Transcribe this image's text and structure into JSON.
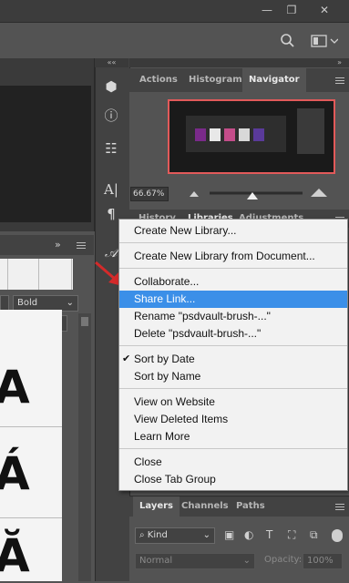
{
  "window": {
    "minimize_icon": "minimize-icon",
    "restore_icon": "restore-icon",
    "close_icon": "close-icon"
  },
  "options_bar": {
    "search_icon": "search-icon",
    "workspace_icon": "workspace-icon"
  },
  "dock": {
    "collapse_label": "««",
    "icons": [
      "3d-icon",
      "info-icon",
      "properties-icon",
      "character-icon",
      "paragraph-icon",
      "glyphs-icon"
    ]
  },
  "panel_strip": {
    "expand_label": "»"
  },
  "navigator_panel": {
    "tabs": [
      {
        "label": "Actions",
        "active": false
      },
      {
        "label": "Histogram",
        "active": false
      },
      {
        "label": "Navigator",
        "active": true
      }
    ],
    "zoom": "66.67%"
  },
  "libraries_tabs": {
    "tabs": [
      "History",
      "Libraries",
      "Adjustments"
    ]
  },
  "glyph_panel": {
    "expand_label": "»",
    "font_style": "Bold",
    "glyphs": [
      "A",
      "Á",
      "Ă"
    ]
  },
  "context_menu": {
    "items": [
      {
        "label": "Create New Library...",
        "highlighted": false,
        "checked": false
      },
      {
        "label": "Create New Library from Document...",
        "highlighted": false,
        "checked": false
      },
      {
        "label": "Collaborate...",
        "highlighted": false,
        "checked": false
      },
      {
        "label": "Share Link...",
        "highlighted": true,
        "checked": false
      },
      {
        "label": "Rename \"psdvault-brush-...\"",
        "highlighted": false,
        "checked": false
      },
      {
        "label": "Delete \"psdvault-brush-...\"",
        "highlighted": false,
        "checked": false
      },
      {
        "label": "Sort by Date",
        "highlighted": false,
        "checked": true
      },
      {
        "label": "Sort by Name",
        "highlighted": false,
        "checked": false
      },
      {
        "label": "View on Website",
        "highlighted": false,
        "checked": false
      },
      {
        "label": "View Deleted Items",
        "highlighted": false,
        "checked": false
      },
      {
        "label": "Learn More",
        "highlighted": false,
        "checked": false
      },
      {
        "label": "Close",
        "highlighted": false,
        "checked": false
      },
      {
        "label": "Close Tab Group",
        "highlighted": false,
        "checked": false
      }
    ],
    "checkmark": "✔"
  },
  "layers_panel": {
    "tabs": [
      {
        "label": "Layers",
        "active": true
      },
      {
        "label": "Channels",
        "active": false
      },
      {
        "label": "Paths",
        "active": false
      }
    ],
    "filter_label": "Kind",
    "blend_mode": "Normal",
    "opacity_label": "Opacity:",
    "opacity_value": "100%"
  },
  "colors": {
    "accent": "#3b8fe8",
    "navigator_frame": "#e25a5a",
    "arrow": "#d42a2a"
  }
}
